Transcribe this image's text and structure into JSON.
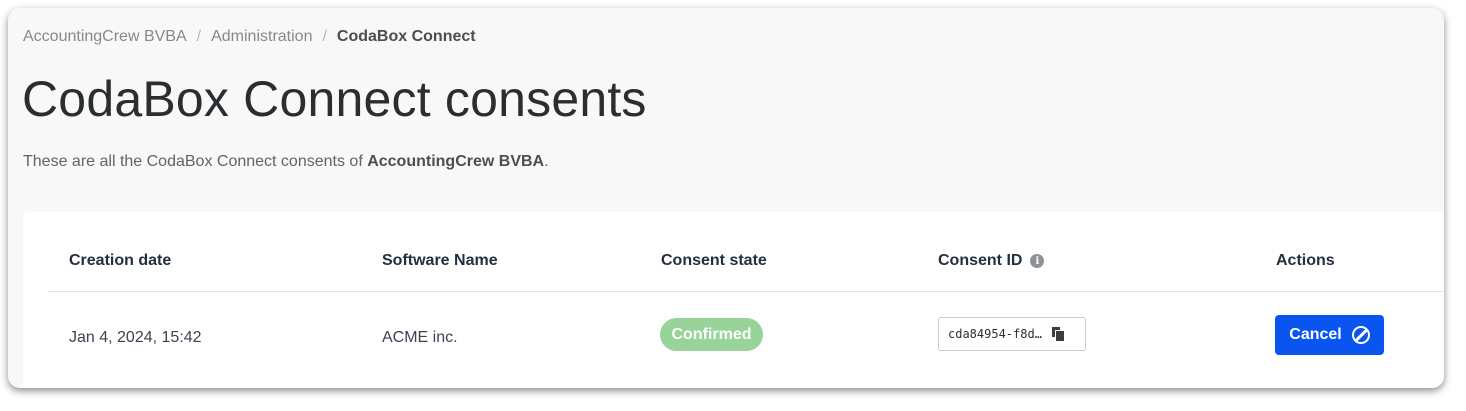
{
  "breadcrumb": {
    "items": [
      "AccountingCrew BVBA",
      "Administration",
      "CodaBox Connect"
    ],
    "separator": "/"
  },
  "page": {
    "title": "CodaBox Connect consents",
    "subtitle_prefix": "These are all the CodaBox Connect consents of ",
    "subtitle_company": "AccountingCrew BVBA",
    "subtitle_suffix": "."
  },
  "table": {
    "headers": {
      "creation_date": "Creation date",
      "software_name": "Software Name",
      "consent_state": "Consent state",
      "consent_id": "Consent ID",
      "actions": "Actions"
    },
    "info_icon_glyph": "i",
    "rows": [
      {
        "creation_date": "Jan 4, 2024, 15:42",
        "software_name": "ACME inc.",
        "consent_state": "Confirmed",
        "consent_id": "cda84954-f8d…",
        "action_label": "Cancel"
      }
    ]
  },
  "icons": {
    "info": "info-icon",
    "copy": "copy-icon",
    "cancel": "ban-icon"
  },
  "colors": {
    "confirmed_badge": "#98d39a",
    "primary_button": "#0a55f0",
    "background": "#f8f8f8"
  }
}
